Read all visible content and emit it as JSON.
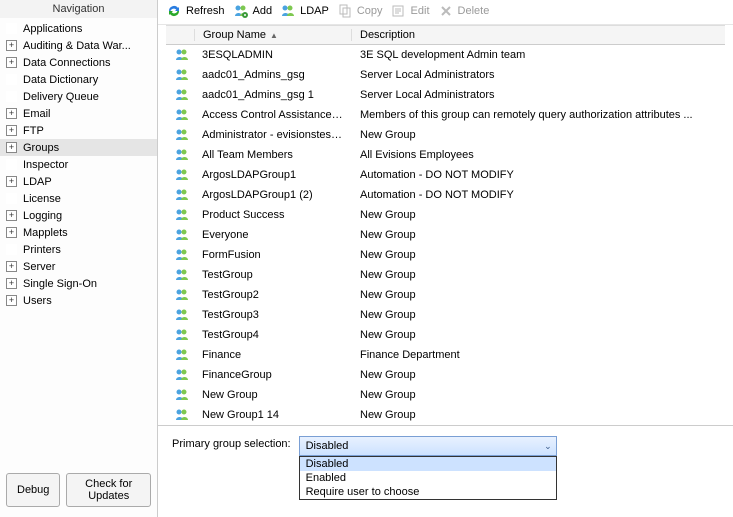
{
  "nav": {
    "header": "Navigation",
    "items": [
      {
        "label": "Applications",
        "exp": ""
      },
      {
        "label": "Auditing & Data War...",
        "exp": "+"
      },
      {
        "label": "Data Connections",
        "exp": "+"
      },
      {
        "label": "Data Dictionary",
        "exp": ""
      },
      {
        "label": "Delivery Queue",
        "exp": ""
      },
      {
        "label": "Email",
        "exp": "+"
      },
      {
        "label": "FTP",
        "exp": "+"
      },
      {
        "label": "Groups",
        "exp": "+",
        "selected": true
      },
      {
        "label": "Inspector",
        "exp": ""
      },
      {
        "label": "LDAP",
        "exp": "+"
      },
      {
        "label": "License",
        "exp": ""
      },
      {
        "label": "Logging",
        "exp": "+"
      },
      {
        "label": "Mapplets",
        "exp": "+"
      },
      {
        "label": "Printers",
        "exp": ""
      },
      {
        "label": "Server",
        "exp": "+"
      },
      {
        "label": "Single Sign-On",
        "exp": "+"
      },
      {
        "label": "Users",
        "exp": "+"
      }
    ],
    "debug": "Debug",
    "check_updates": "Check for Updates"
  },
  "toolbar": {
    "refresh": "Refresh",
    "add": "Add",
    "ldap": "LDAP",
    "copy": "Copy",
    "edit": "Edit",
    "delete": "Delete"
  },
  "grid": {
    "col_group": "Group Name",
    "col_desc": "Description",
    "rows": [
      {
        "name": "3ESQLADMIN",
        "desc": "3E SQL development Admin team"
      },
      {
        "name": "aadc01_Admins_gsg",
        "desc": "Server Local Administrators"
      },
      {
        "name": "aadc01_Admins_gsg 1",
        "desc": "Server Local Administrators"
      },
      {
        "name": "Access Control Assistance Ope...",
        "desc": "Members of this group can remotely query authorization attributes ..."
      },
      {
        "name": "Administrator - evisionstest.com",
        "desc": "New Group"
      },
      {
        "name": "All Team Members",
        "desc": "All Evisions Employees"
      },
      {
        "name": "ArgosLDAPGroup1",
        "desc": "Automation - DO NOT MODIFY"
      },
      {
        "name": "ArgosLDAPGroup1 (2)",
        "desc": "Automation - DO NOT MODIFY"
      },
      {
        "name": "Product Success",
        "desc": "New Group"
      },
      {
        "name": "Everyone",
        "desc": "New Group"
      },
      {
        "name": "FormFusion",
        "desc": "New Group"
      },
      {
        "name": "TestGroup",
        "desc": "New Group"
      },
      {
        "name": "TestGroup2",
        "desc": "New Group"
      },
      {
        "name": "TestGroup3",
        "desc": "New Group"
      },
      {
        "name": "TestGroup4",
        "desc": "New Group"
      },
      {
        "name": "Finance",
        "desc": "Finance Department"
      },
      {
        "name": "FinanceGroup",
        "desc": "New Group"
      },
      {
        "name": "New Group",
        "desc": "New Group"
      },
      {
        "name": "New Group1 14",
        "desc": "New Group"
      }
    ]
  },
  "pgs": {
    "label": "Primary group selection:",
    "selected": "Disabled",
    "options": [
      "Disabled",
      "Enabled",
      "Require user to choose"
    ]
  }
}
